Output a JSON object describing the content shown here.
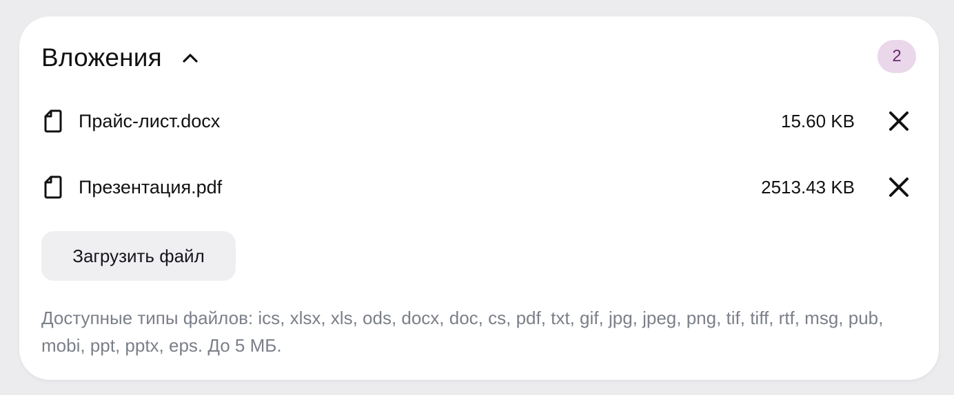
{
  "attachments": {
    "title": "Вложения",
    "count": "2",
    "files": [
      {
        "name": "Прайс-лист.docx",
        "size": "15.60 KB"
      },
      {
        "name": "Презентация.pdf",
        "size": "2513.43 KB"
      }
    ],
    "upload_label": "Загрузить файл",
    "hint": "Доступные типы файлов: ics, xlsx, xls, ods, docx, doc, cs, pdf, txt, gif, jpg, jpeg, png, tif, tiff, rtf, msg, pub, mobi, ppt, pptx, eps. До 5 МБ."
  },
  "icons": {
    "collapse": "chevron-up-icon",
    "file": "file-icon",
    "remove": "close-icon"
  },
  "colors": {
    "badge_bg": "#ead7ea",
    "badge_text": "#6e2a72",
    "hint_text": "#7b7f88",
    "button_bg": "#efeff2"
  }
}
